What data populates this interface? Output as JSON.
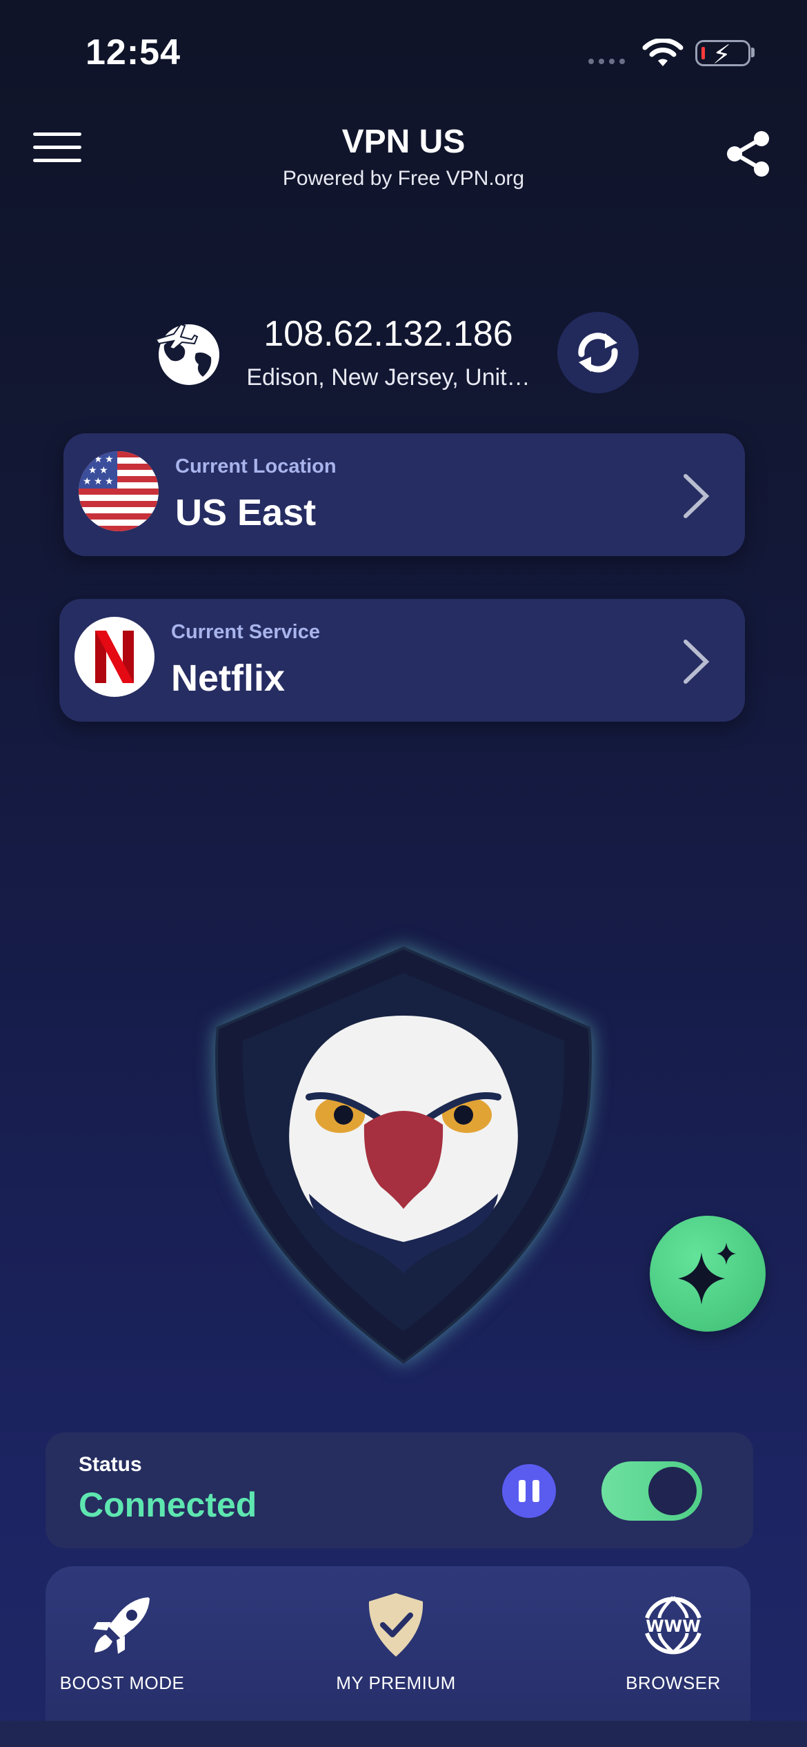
{
  "status_bar": {
    "time": "12:54"
  },
  "header": {
    "title": "VPN US",
    "subtitle": "Powered by Free VPN.org"
  },
  "connection": {
    "ip": "108.62.132.186",
    "location": "Edison, New Jersey, Unit…"
  },
  "location_card": {
    "kicker": "Current Location",
    "value": "US East"
  },
  "service_card": {
    "kicker": "Current Service",
    "value": "Netflix"
  },
  "status": {
    "label": "Status",
    "value": "Connected",
    "toggle_on": true
  },
  "nav": {
    "items": [
      {
        "label": "BOOST MODE",
        "icon": "rocket-icon"
      },
      {
        "label": "MY PREMIUM",
        "icon": "shield-check-icon"
      },
      {
        "label": "BROWSER",
        "icon": "www-globe-icon"
      }
    ]
  },
  "colors": {
    "accent_green": "#5ee6b0",
    "card_bg": "#262d62",
    "pause_button": "#5a5cf0",
    "fab_green": "#4fcf88"
  }
}
